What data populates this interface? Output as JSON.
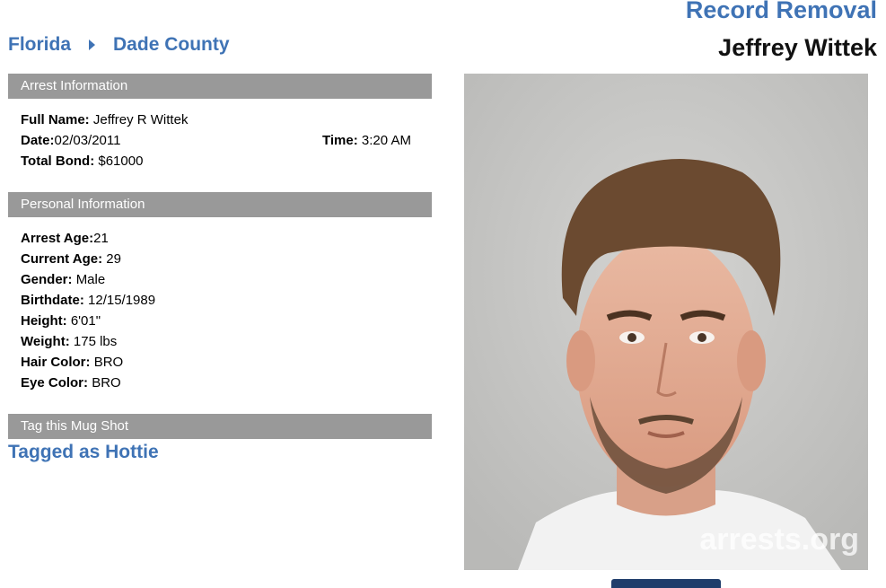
{
  "header": {
    "record_removal": "Record Removal",
    "name": "Jeffrey Wittek"
  },
  "breadcrumb": {
    "state": "Florida",
    "county": "Dade County"
  },
  "arrest": {
    "header": "Arrest Information",
    "full_name_label": "Full Name:",
    "full_name": "Jeffrey R Wittek",
    "date_label": "Date:",
    "date": "02/03/2011",
    "time_label": "Time:",
    "time": "3:20 AM",
    "bond_label": "Total Bond:",
    "bond": "$61000"
  },
  "personal": {
    "header": "Personal Information",
    "fields": [
      {
        "label": "Arrest Age:",
        "value": "21"
      },
      {
        "label": "Current Age:",
        "value": "29"
      },
      {
        "label": "Gender:",
        "value": "Male"
      },
      {
        "label": "Birthdate:",
        "value": "12/15/1989"
      },
      {
        "label": "Height:",
        "value": "6'01\""
      },
      {
        "label": "Weight:",
        "value": "175 lbs"
      },
      {
        "label": "Hair Color:",
        "value": "BRO"
      },
      {
        "label": "Eye Color:",
        "value": "BRO"
      }
    ]
  },
  "tag": {
    "header": "Tag this Mug Shot",
    "tagged": "Tagged as Hottie"
  },
  "photo": {
    "watermark": "arrests.org"
  },
  "colors": {
    "link": "#3f73b5",
    "section_bg": "#999999"
  }
}
